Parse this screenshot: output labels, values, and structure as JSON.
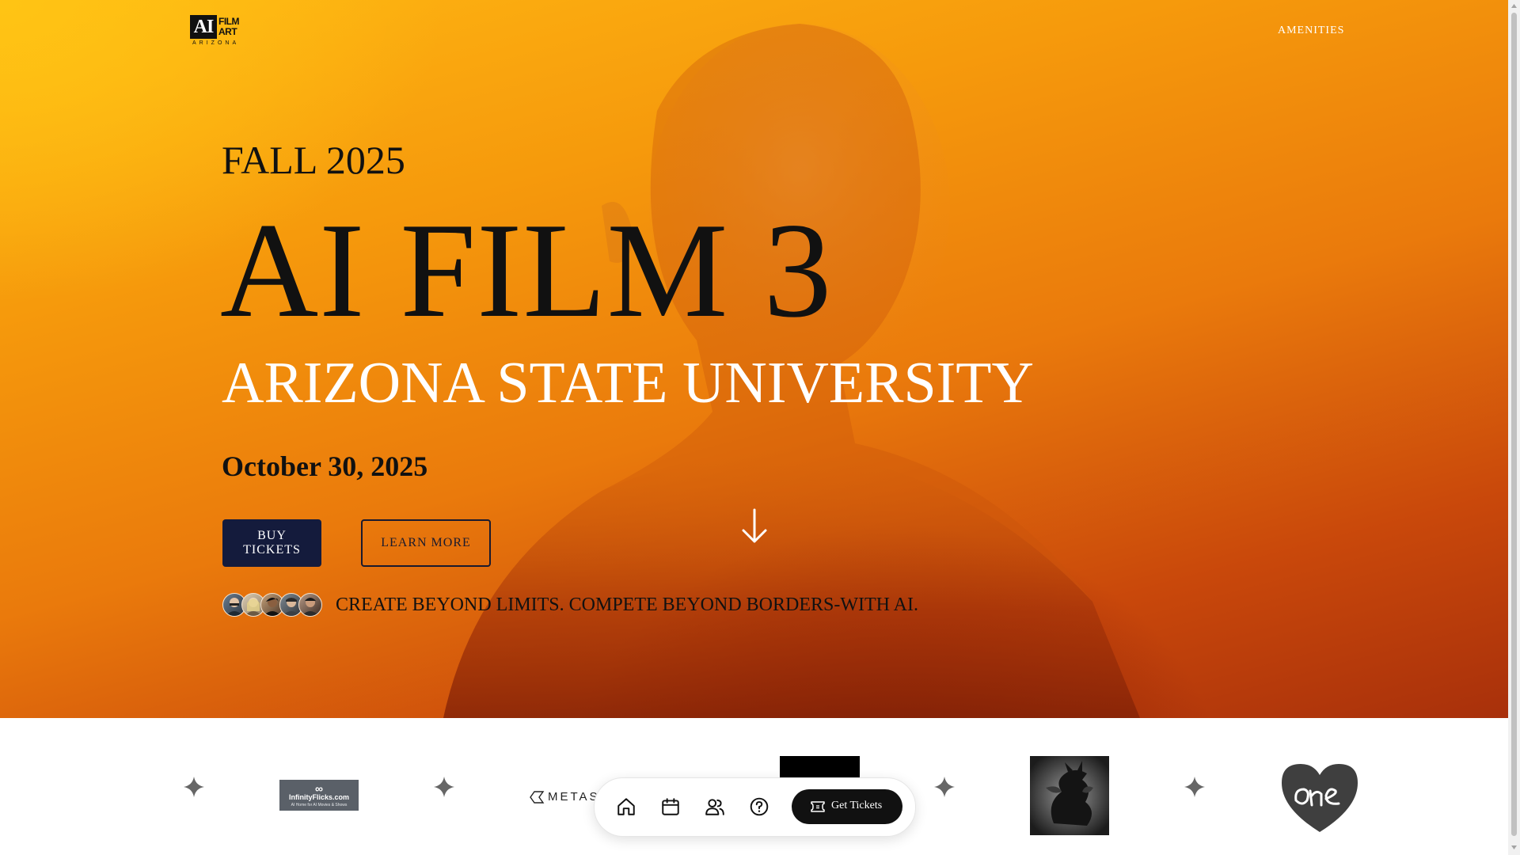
{
  "header": {
    "logo": {
      "main": "AI",
      "line1": "FILM",
      "line2": "ART",
      "line3": "ARIZONA"
    },
    "nav_amenities": "AMENITIES"
  },
  "hero": {
    "season": "FALL 2025",
    "title": "AI FILM 3",
    "subtitle": "ARIZONA STATE UNIVERSITY",
    "date": "October 30, 2025",
    "buy_label": "BUY TICKETS",
    "learn_label": "LEARN MORE",
    "tagline": "CREATE BEYOND LIMITS. COMPETE BEYOND BORDERS-WITH AI."
  },
  "sponsors": {
    "infinity": {
      "name": "InfinityFlicks.com",
      "sub": "AI Home for AI Movies & Shows"
    },
    "metasi": "METASI"
  },
  "dock": {
    "items": [
      "home-icon",
      "calendar-icon",
      "users-icon",
      "help-icon"
    ],
    "tickets_label": "Get Tickets"
  },
  "colors": {
    "hero_top": "#ffb812",
    "hero_mid": "#ea7a0c",
    "hero_bottom": "#a8300b",
    "buy_button": "#141b3c",
    "dock_button": "#111111"
  }
}
